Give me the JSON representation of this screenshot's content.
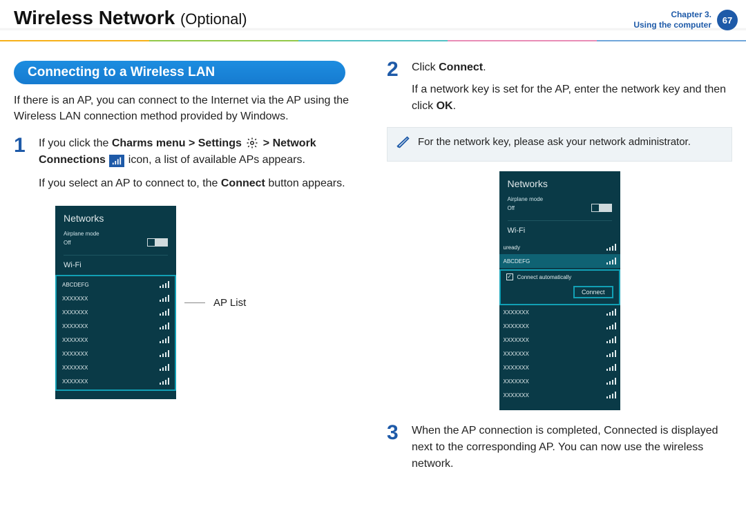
{
  "header": {
    "title_main": "Wireless Network",
    "title_suffix": "(Optional)",
    "chapter_line1": "Chapter 3.",
    "chapter_line2": "Using the computer",
    "page_number": "67"
  },
  "left": {
    "section_title": "Connecting to a Wireless LAN",
    "intro": "If there is an AP, you can connect to the Internet via the AP using the Wireless LAN connection method provided by Windows.",
    "step1_num": "1",
    "step1_line1_a": "If you click the ",
    "step1_line1_b": "Charms menu > Settings ",
    "step1_line1_c": " > Network Connections ",
    "step1_line1_d": " icon, a list of available APs appears.",
    "step1_line2_a": "If you select an AP to connect to, the ",
    "step1_line2_b": "Connect",
    "step1_line2_c": " button appears.",
    "ap_list_label": "AP List"
  },
  "right": {
    "step2_num": "2",
    "step2_line1_a": "Click ",
    "step2_line1_b": "Connect",
    "step2_line1_c": ".",
    "step2_line2_a": "If a network key is set for the AP, enter the network key and then click ",
    "step2_line2_b": "OK",
    "step2_line2_c": ".",
    "note": "For the network key, please ask your network administrator.",
    "step3_num": "3",
    "step3_text": "When the AP connection is completed, Connected is displayed next to the corresponding AP. You can now use the wireless network."
  },
  "panel_a": {
    "title": "Networks",
    "airplane_label": "Airplane mode",
    "off_label": "Off",
    "wifi_label": "Wi-Fi",
    "items": [
      {
        "ssid": "ABCDEFG"
      },
      {
        "ssid": "XXXXXXX"
      },
      {
        "ssid": "XXXXXXX"
      },
      {
        "ssid": "XXXXXXX"
      },
      {
        "ssid": "XXXXXXX"
      },
      {
        "ssid": "XXXXXXX"
      },
      {
        "ssid": "XXXXXXX"
      },
      {
        "ssid": "XXXXXXX"
      }
    ]
  },
  "panel_b": {
    "title": "Networks",
    "airplane_label": "Airplane mode",
    "off_label": "Off",
    "wifi_label": "Wi-Fi",
    "top_items": [
      {
        "ssid": "uready"
      },
      {
        "ssid": "ABCDEFG"
      }
    ],
    "auto_label": "Connect automatically",
    "connect_label": "Connect",
    "bottom_items": [
      {
        "ssid": "XXXXXXX"
      },
      {
        "ssid": "XXXXXXX"
      },
      {
        "ssid": "XXXXXXX"
      },
      {
        "ssid": "XXXXXXX"
      },
      {
        "ssid": "XXXXXXX"
      },
      {
        "ssid": "XXXXXXX"
      },
      {
        "ssid": "XXXXXXX"
      }
    ]
  }
}
